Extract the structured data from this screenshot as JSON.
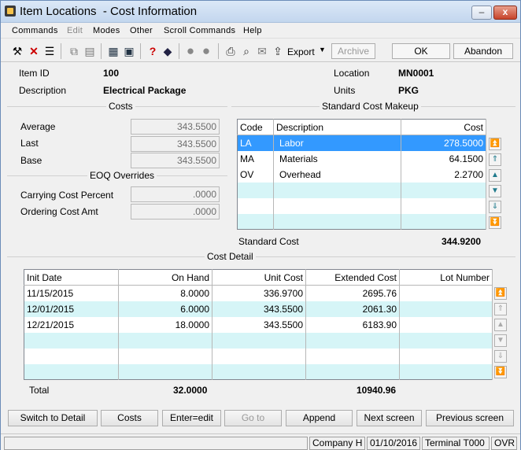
{
  "window": {
    "title": "Item Locations  - Cost Information",
    "minimize": "–",
    "maximize": "□",
    "close": "x"
  },
  "menu": [
    "Commands",
    "Edit",
    "Modes",
    "Other",
    "Scroll Commands",
    "Help"
  ],
  "toolbar": {
    "export_label": "Export",
    "archive_label": "Archive",
    "ok_label": "OK",
    "abandon_label": "Abandon"
  },
  "header": {
    "item_id_label": "Item ID",
    "item_id": "100",
    "description_label": "Description",
    "description": "Electrical Package",
    "location_label": "Location",
    "location": "MN0001",
    "units_label": "Units",
    "units": "PKG"
  },
  "costs": {
    "title": "Costs",
    "average_label": "Average",
    "average": "343.5500",
    "last_label": "Last",
    "last": "343.5500",
    "base_label": "Base",
    "base": "343.5500"
  },
  "eoq": {
    "title": "EOQ Overrides",
    "carrying_label": "Carrying Cost Percent",
    "carrying": ".0000",
    "ordering_label": "Ordering Cost Amt",
    "ordering": ".0000"
  },
  "makeup": {
    "title": "Standard Cost Makeup",
    "columns": [
      "Code",
      "Description",
      "Cost"
    ],
    "rows": [
      {
        "code": "LA",
        "description": "Labor",
        "cost": "278.5000"
      },
      {
        "code": "MA",
        "description": "Materials",
        "cost": "64.1500"
      },
      {
        "code": "OV",
        "description": "Overhead",
        "cost": "2.2700"
      }
    ],
    "standard_cost_label": "Standard Cost",
    "standard_cost": "344.9200"
  },
  "detail": {
    "title": "Cost Detail",
    "columns": [
      "Init Date",
      "On Hand",
      "Unit Cost",
      "Extended Cost",
      "Lot Number"
    ],
    "rows": [
      {
        "date": "11/15/2015",
        "on_hand": "8.0000",
        "unit_cost": "336.9700",
        "extended": "2695.76",
        "lot": ""
      },
      {
        "date": "12/01/2015",
        "on_hand": "6.0000",
        "unit_cost": "343.5500",
        "extended": "2061.30",
        "lot": ""
      },
      {
        "date": "12/21/2015",
        "on_hand": "18.0000",
        "unit_cost": "343.5500",
        "extended": "6183.90",
        "lot": ""
      }
    ],
    "total_label": "Total",
    "total_on_hand": "32.0000",
    "total_extended": "10940.96"
  },
  "buttons": {
    "switch": "Switch to Detail",
    "costs": "Costs",
    "enter_edit": "Enter=edit",
    "go_to": "Go to",
    "append": "Append",
    "next_screen": "Next screen",
    "previous_screen": "Previous screen"
  },
  "status": {
    "company": "Company H",
    "date": "01/10/2016",
    "terminal": "Terminal T000",
    "mode": "OVR"
  }
}
